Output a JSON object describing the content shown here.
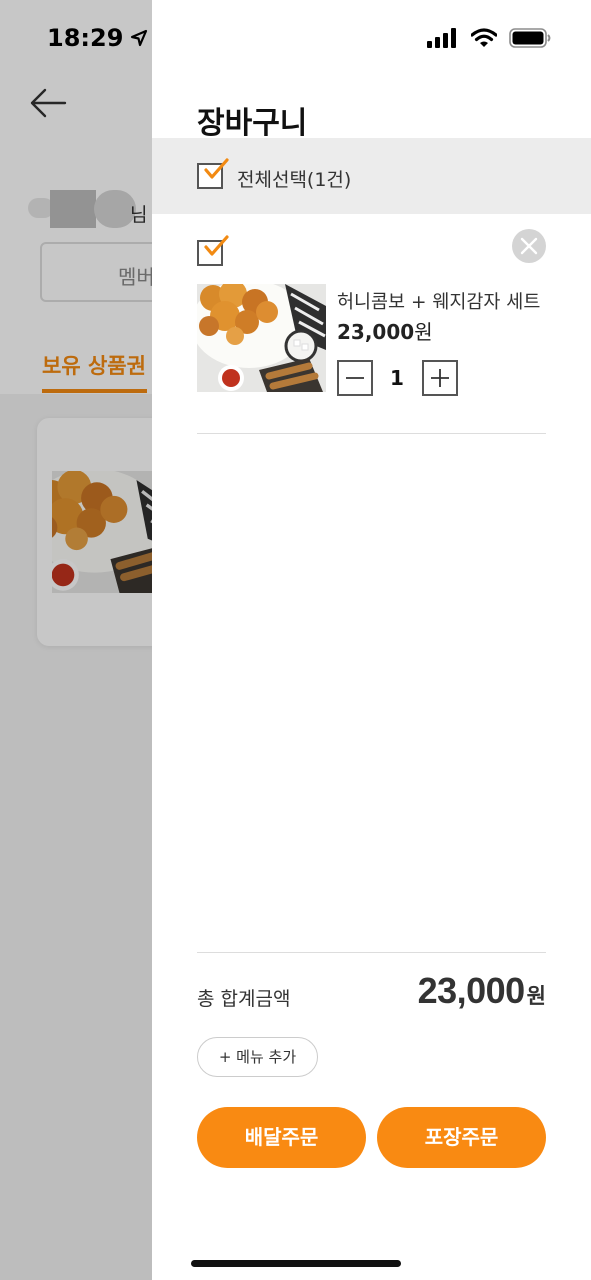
{
  "status_bar": {
    "time": "18:29"
  },
  "background_page": {
    "name_suffix": "님",
    "member_button_label": "멤버",
    "active_tab_label": "보유 상품권"
  },
  "cart": {
    "title": "장바구니",
    "select_all_label": "전체선택(1건)",
    "items": [
      {
        "name": "허니콤보 + 웨지감자 세트",
        "price": "23,000",
        "price_unit": "원",
        "quantity": "1",
        "checked": true
      }
    ],
    "total_label": "총 합계금액",
    "total_amount": "23,000",
    "total_unit": "원",
    "add_menu_label": "+ 메뉴 추가",
    "delivery_order_label": "배달주문",
    "takeout_order_label": "포장주문"
  },
  "colors": {
    "accent": "#f98a12",
    "checkmark": "#f28a12"
  },
  "icons": {
    "back": "arrow-left-icon",
    "location": "location-arrow-icon",
    "signal": "cellular-signal-icon",
    "wifi": "wifi-icon",
    "battery": "battery-icon",
    "remove": "close-icon",
    "minus": "minus-icon",
    "plus": "plus-icon",
    "checkbox": "checkmark-icon"
  }
}
